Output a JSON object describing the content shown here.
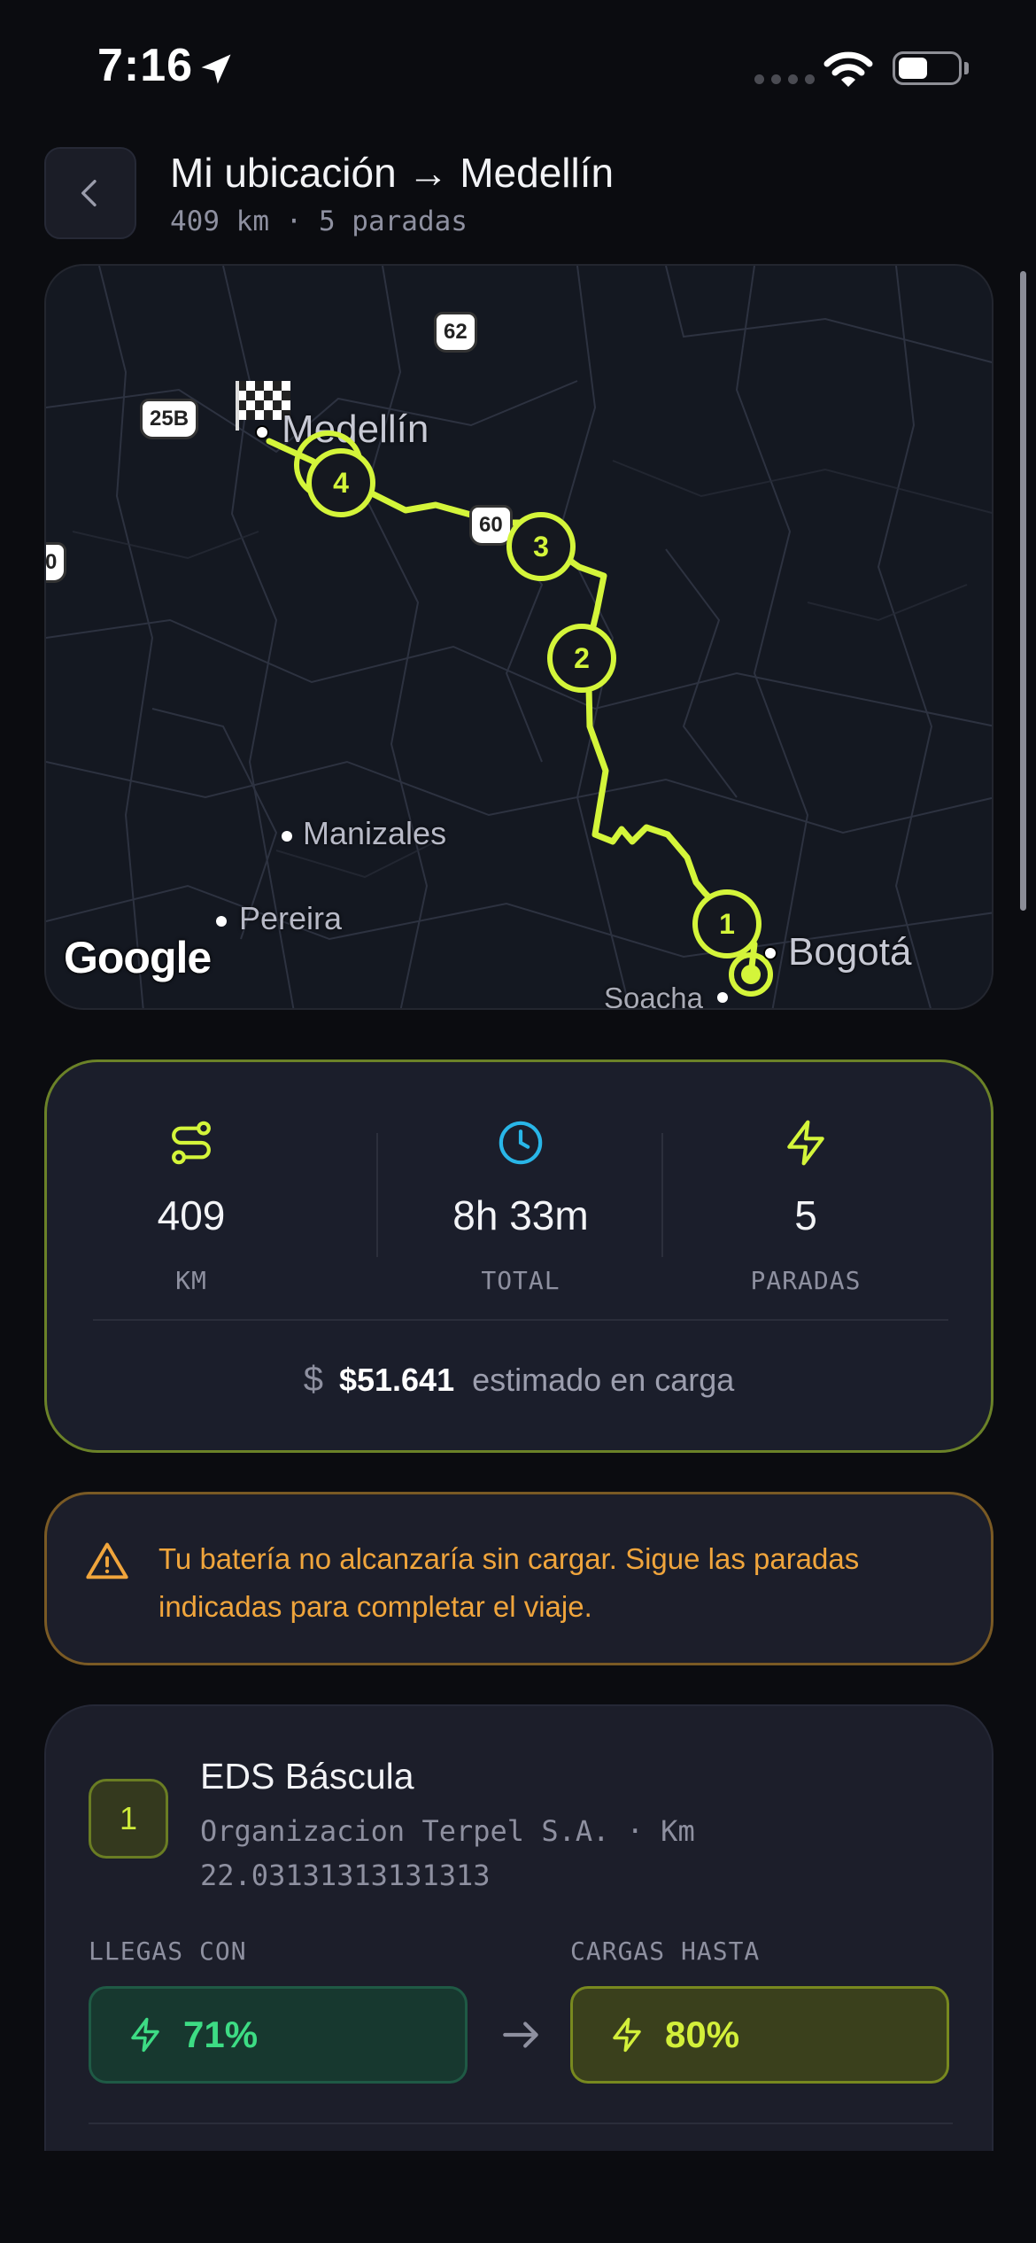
{
  "status_bar": {
    "time": "7:16"
  },
  "header": {
    "title": "Mi ubicación → Medellín",
    "subtitle": "409 km · 5 paradas"
  },
  "map": {
    "attribution": "Google",
    "cities": {
      "medellin": "Medellín",
      "manizales": "Manizales",
      "pereira": "Pereira",
      "bogota": "Bogotá",
      "soacha": "Soacha"
    },
    "road_shields": {
      "r62": "62",
      "r25b": "25B",
      "r60": "60",
      "r0": "0"
    },
    "stops": [
      "1",
      "2",
      "3",
      "4"
    ],
    "route_color": "#d4f53a"
  },
  "summary": {
    "distance": {
      "value": "409",
      "label": "KM",
      "icon": "route-icon"
    },
    "duration": {
      "value": "8h 33m",
      "label": "TOTAL",
      "icon": "clock-icon"
    },
    "stops": {
      "value": "5",
      "label": "PARADAS",
      "icon": "bolt-icon"
    },
    "cost_symbol": "$",
    "cost_amount": "$51.641",
    "cost_label": "estimado en carga"
  },
  "warning": {
    "icon": "warning-triangle-icon",
    "text": "Tu batería no alcanzaría sin cargar. Sigue las paradas indicadas para completar el viaje."
  },
  "stop_card": {
    "number": "1",
    "name": "EDS Báscula",
    "detail": "Organizacion Terpel S.A.  ·  Km 22.03131313131313",
    "arrive_label": "LLEGAS CON",
    "arrive_value": "71%",
    "charge_label": "CARGAS HASTA",
    "charge_value": "80%"
  },
  "colors": {
    "accent": "#d4f53a",
    "arrive_green": "#3ddc84",
    "warning_orange": "#f0a53c",
    "clock_cyan": "#29b6e8"
  }
}
